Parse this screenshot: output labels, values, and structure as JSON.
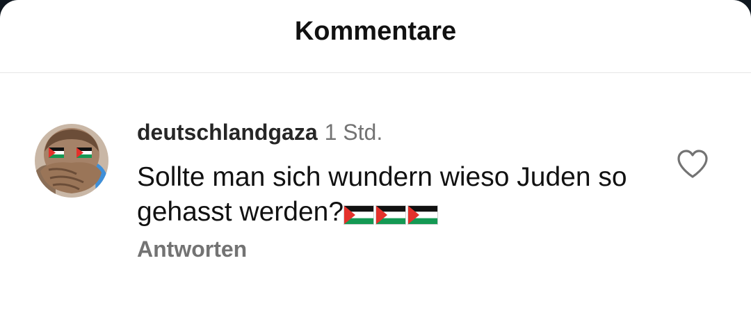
{
  "header": {
    "title": "Kommentare"
  },
  "comment": {
    "username": "deutschlandgaza",
    "time": "1 Std.",
    "text": "Sollte man sich wundern wieso Juden so gehasst werden?",
    "emoji": [
      "palestine-flag",
      "palestine-flag",
      "palestine-flag"
    ],
    "reply_label": "Antworten",
    "like_icon": "heart-outline-icon"
  },
  "colors": {
    "primary_text": "#111111",
    "secondary_text": "#737373",
    "divider": "#e6e6e6",
    "flag_green": "#149954",
    "flag_red": "#e4312b"
  }
}
